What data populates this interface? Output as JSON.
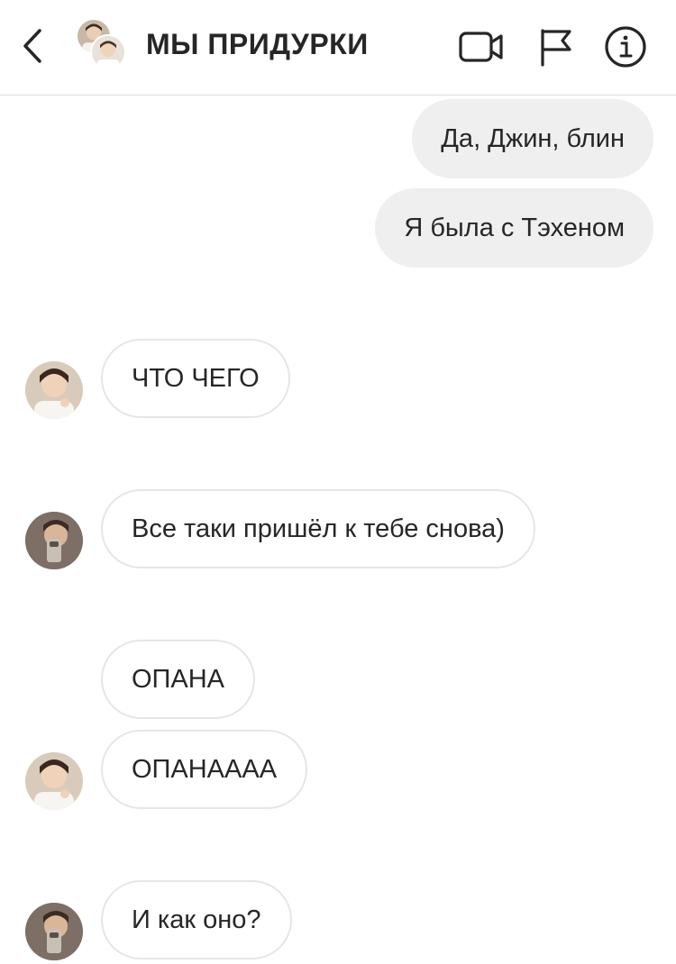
{
  "header": {
    "title": "МЫ ПРИДУРКИ",
    "back_icon": "chevron-left-icon",
    "video_icon": "video-camera-icon",
    "flag_icon": "flag-icon",
    "info_icon": "info-circle-icon"
  },
  "messages": [
    {
      "direction": "outgoing",
      "text": "Да, Джин, блин"
    },
    {
      "direction": "outgoing",
      "text": "Я была с Тэхеном"
    },
    {
      "direction": "incoming",
      "sender": "jin",
      "text": "ЧТО ЧЕГО"
    },
    {
      "direction": "incoming",
      "sender": "namjoon",
      "text": "Все таки пришёл к тебе снова)"
    },
    {
      "direction": "incoming",
      "sender": "jin",
      "text": "ОПАНА"
    },
    {
      "direction": "incoming",
      "sender": "jin",
      "text": "ОПАНАААА"
    },
    {
      "direction": "incoming",
      "sender": "namjoon",
      "text": "И как оно?"
    }
  ],
  "colors": {
    "outgoing_bubble": "#efefef",
    "incoming_border": "#e6e6e6",
    "text": "#262626",
    "divider": "#dbdbdb"
  }
}
